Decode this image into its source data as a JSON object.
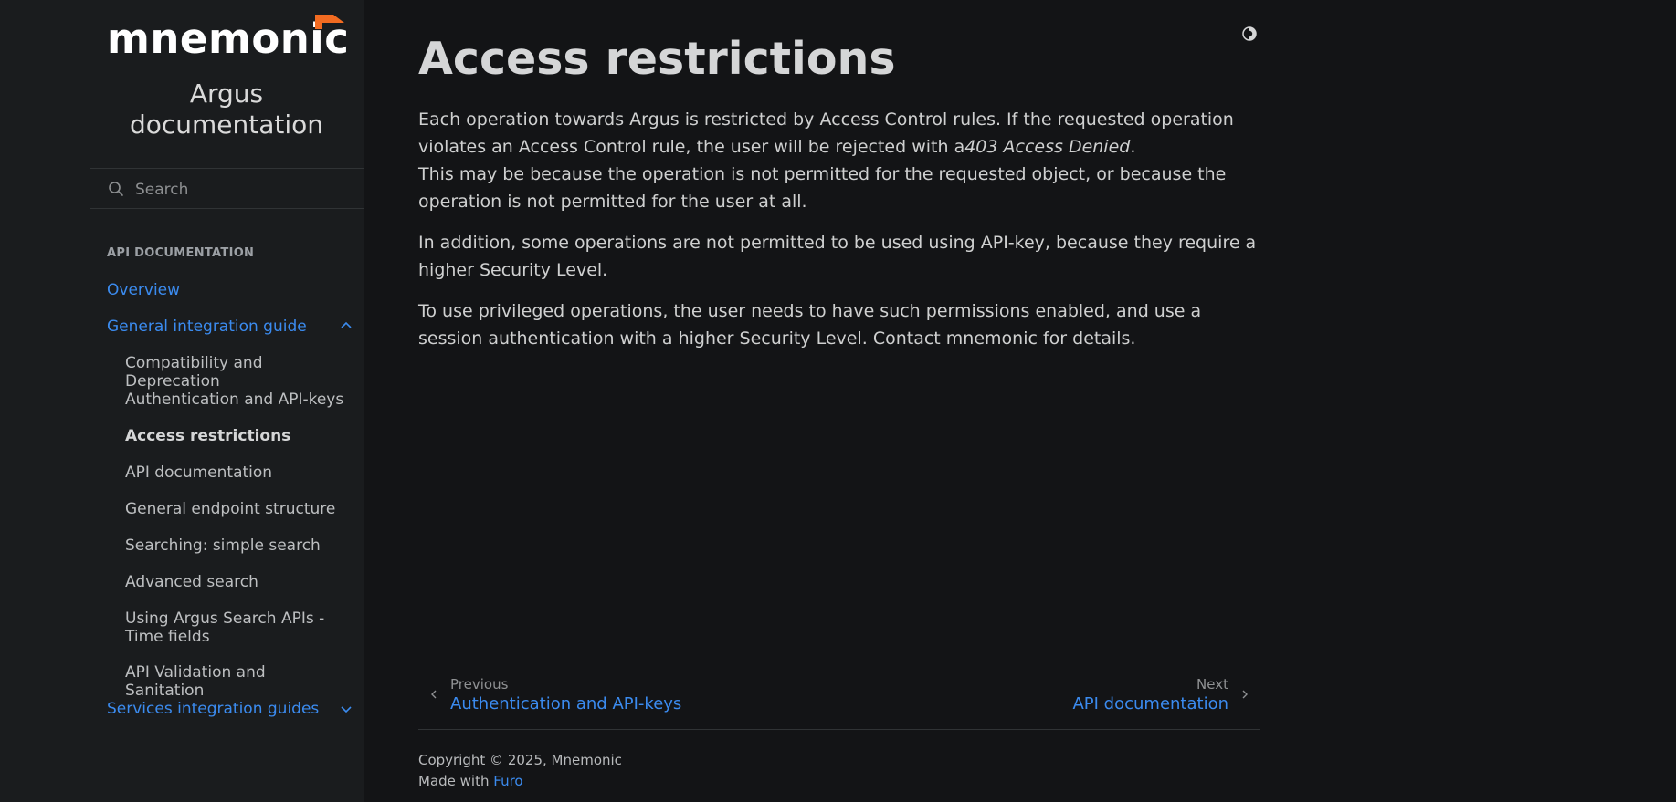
{
  "sidebar": {
    "logo_text": "mnemonic",
    "project_name": "Argus documentation",
    "search": {
      "placeholder": "Search"
    },
    "caption": "API DOCUMENTATION",
    "items": [
      {
        "label": "Overview"
      },
      {
        "label": "General integration guide",
        "expanded": true
      },
      {
        "label": "Compatibility and Deprecation"
      },
      {
        "label": "Authentication and API-keys"
      },
      {
        "label": "Access restrictions",
        "current": true
      },
      {
        "label": "API documentation"
      },
      {
        "label": "General endpoint structure"
      },
      {
        "label": "Searching: simple search"
      },
      {
        "label": "Advanced search"
      },
      {
        "label": "Using Argus Search APIs - Time fields"
      },
      {
        "label": "API Validation and Sanitation"
      },
      {
        "label": "Services integration guides",
        "expanded": false
      }
    ],
    "colors": {
      "accent": "#3b8bef",
      "logo_flag": "#f26b21"
    }
  },
  "page": {
    "title": "Access restrictions",
    "p1_a": "Each operation towards Argus is restricted by Access Control rules. If the requested operation violates an Access Control rule, the user will be rejected with a",
    "p1_em": "403 Access Denied",
    "p1_b": ".",
    "p1_c": "This may be because the operation is not permitted for the requested object, or because the operation is not permitted for the user at all.",
    "p2": "In addition, some operations are not permitted to be used using API-key, because they require a higher Security Level.",
    "p3": "To use privileged operations, the user needs to have such permissions enabled, and use a session authentication with a higher Security Level. Contact mnemonic for details."
  },
  "prev": {
    "label": "Previous",
    "title": "Authentication and API-keys"
  },
  "next": {
    "label": "Next",
    "title": "API documentation"
  },
  "footer": {
    "copyright": "Copyright © 2025, Mnemonic",
    "made_with": "Made with",
    "furo": "Furo"
  }
}
